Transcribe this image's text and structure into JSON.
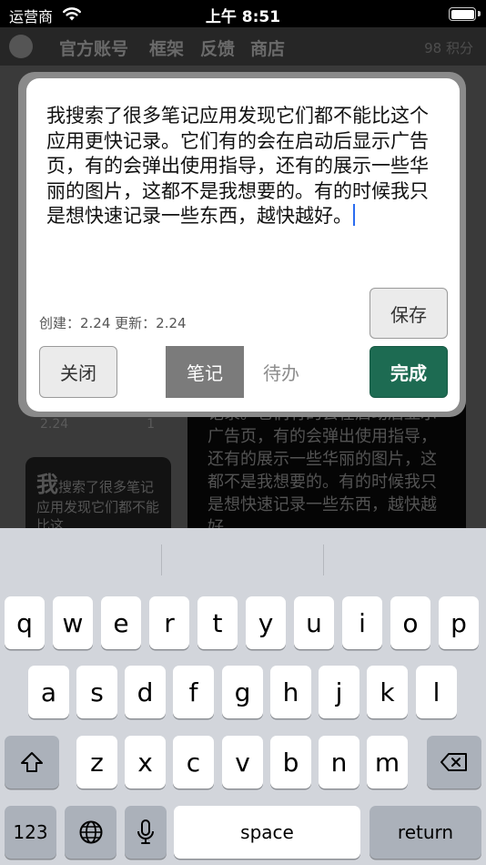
{
  "status_bar": {
    "carrier": "运营商",
    "time": "上午 8:51",
    "battery_level": 1.0
  },
  "top_nav": {
    "items": [
      "官方账号",
      "框架",
      "反馈",
      "商店"
    ],
    "points": "98 积分"
  },
  "background": {
    "left_date": "2.24",
    "left_count": "1",
    "card_first_char": "我",
    "card_rest": "搜索了很多笔记应用发现它们都不能比这...",
    "right_text": "记录。它们有的会在启动后显示广告页，有的会弹出使用指导，还有的展示一些华丽的图片，这都不是我想要的。有的时候我只是想快速记录一些东西，越快越好。"
  },
  "modal": {
    "note_text": "我搜索了很多笔记应用发现它们都不能比这个应用更快记录。它们有的会在启动后显示广告页，有的会弹出使用指导，还有的展示一些华丽的图片，这都不是我想要的。有的时候我只是想快速记录一些东西，越快越好。",
    "meta": "创建：2.24 更新：2.24",
    "save_label": "保存",
    "close_label": "关闭",
    "note_tab_label": "笔记",
    "todo_tab_label": "待办",
    "done_label": "完成",
    "accent_color": "#1d6b52"
  },
  "keyboard": {
    "row1": [
      "q",
      "w",
      "e",
      "r",
      "t",
      "y",
      "u",
      "i",
      "o",
      "p"
    ],
    "row2": [
      "a",
      "s",
      "d",
      "f",
      "g",
      "h",
      "j",
      "k",
      "l"
    ],
    "row3": [
      "z",
      "x",
      "c",
      "v",
      "b",
      "n",
      "m"
    ],
    "numbers_label": "123",
    "space_label": "space",
    "return_label": "return",
    "icons": [
      "shift-icon",
      "backspace-icon",
      "globe-icon",
      "microphone-icon"
    ]
  }
}
